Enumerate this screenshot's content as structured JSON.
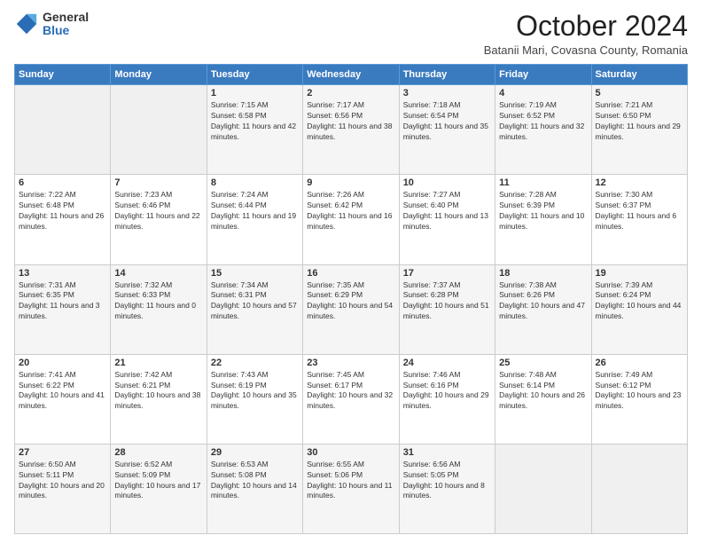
{
  "logo": {
    "general": "General",
    "blue": "Blue"
  },
  "header": {
    "month": "October 2024",
    "location": "Batanii Mari, Covasna County, Romania"
  },
  "days_of_week": [
    "Sunday",
    "Monday",
    "Tuesday",
    "Wednesday",
    "Thursday",
    "Friday",
    "Saturday"
  ],
  "weeks": [
    [
      {
        "day": "",
        "info": ""
      },
      {
        "day": "",
        "info": ""
      },
      {
        "day": "1",
        "info": "Sunrise: 7:15 AM\nSunset: 6:58 PM\nDaylight: 11 hours and 42 minutes."
      },
      {
        "day": "2",
        "info": "Sunrise: 7:17 AM\nSunset: 6:56 PM\nDaylight: 11 hours and 38 minutes."
      },
      {
        "day": "3",
        "info": "Sunrise: 7:18 AM\nSunset: 6:54 PM\nDaylight: 11 hours and 35 minutes."
      },
      {
        "day": "4",
        "info": "Sunrise: 7:19 AM\nSunset: 6:52 PM\nDaylight: 11 hours and 32 minutes."
      },
      {
        "day": "5",
        "info": "Sunrise: 7:21 AM\nSunset: 6:50 PM\nDaylight: 11 hours and 29 minutes."
      }
    ],
    [
      {
        "day": "6",
        "info": "Sunrise: 7:22 AM\nSunset: 6:48 PM\nDaylight: 11 hours and 26 minutes."
      },
      {
        "day": "7",
        "info": "Sunrise: 7:23 AM\nSunset: 6:46 PM\nDaylight: 11 hours and 22 minutes."
      },
      {
        "day": "8",
        "info": "Sunrise: 7:24 AM\nSunset: 6:44 PM\nDaylight: 11 hours and 19 minutes."
      },
      {
        "day": "9",
        "info": "Sunrise: 7:26 AM\nSunset: 6:42 PM\nDaylight: 11 hours and 16 minutes."
      },
      {
        "day": "10",
        "info": "Sunrise: 7:27 AM\nSunset: 6:40 PM\nDaylight: 11 hours and 13 minutes."
      },
      {
        "day": "11",
        "info": "Sunrise: 7:28 AM\nSunset: 6:39 PM\nDaylight: 11 hours and 10 minutes."
      },
      {
        "day": "12",
        "info": "Sunrise: 7:30 AM\nSunset: 6:37 PM\nDaylight: 11 hours and 6 minutes."
      }
    ],
    [
      {
        "day": "13",
        "info": "Sunrise: 7:31 AM\nSunset: 6:35 PM\nDaylight: 11 hours and 3 minutes."
      },
      {
        "day": "14",
        "info": "Sunrise: 7:32 AM\nSunset: 6:33 PM\nDaylight: 11 hours and 0 minutes."
      },
      {
        "day": "15",
        "info": "Sunrise: 7:34 AM\nSunset: 6:31 PM\nDaylight: 10 hours and 57 minutes."
      },
      {
        "day": "16",
        "info": "Sunrise: 7:35 AM\nSunset: 6:29 PM\nDaylight: 10 hours and 54 minutes."
      },
      {
        "day": "17",
        "info": "Sunrise: 7:37 AM\nSunset: 6:28 PM\nDaylight: 10 hours and 51 minutes."
      },
      {
        "day": "18",
        "info": "Sunrise: 7:38 AM\nSunset: 6:26 PM\nDaylight: 10 hours and 47 minutes."
      },
      {
        "day": "19",
        "info": "Sunrise: 7:39 AM\nSunset: 6:24 PM\nDaylight: 10 hours and 44 minutes."
      }
    ],
    [
      {
        "day": "20",
        "info": "Sunrise: 7:41 AM\nSunset: 6:22 PM\nDaylight: 10 hours and 41 minutes."
      },
      {
        "day": "21",
        "info": "Sunrise: 7:42 AM\nSunset: 6:21 PM\nDaylight: 10 hours and 38 minutes."
      },
      {
        "day": "22",
        "info": "Sunrise: 7:43 AM\nSunset: 6:19 PM\nDaylight: 10 hours and 35 minutes."
      },
      {
        "day": "23",
        "info": "Sunrise: 7:45 AM\nSunset: 6:17 PM\nDaylight: 10 hours and 32 minutes."
      },
      {
        "day": "24",
        "info": "Sunrise: 7:46 AM\nSunset: 6:16 PM\nDaylight: 10 hours and 29 minutes."
      },
      {
        "day": "25",
        "info": "Sunrise: 7:48 AM\nSunset: 6:14 PM\nDaylight: 10 hours and 26 minutes."
      },
      {
        "day": "26",
        "info": "Sunrise: 7:49 AM\nSunset: 6:12 PM\nDaylight: 10 hours and 23 minutes."
      }
    ],
    [
      {
        "day": "27",
        "info": "Sunrise: 6:50 AM\nSunset: 5:11 PM\nDaylight: 10 hours and 20 minutes."
      },
      {
        "day": "28",
        "info": "Sunrise: 6:52 AM\nSunset: 5:09 PM\nDaylight: 10 hours and 17 minutes."
      },
      {
        "day": "29",
        "info": "Sunrise: 6:53 AM\nSunset: 5:08 PM\nDaylight: 10 hours and 14 minutes."
      },
      {
        "day": "30",
        "info": "Sunrise: 6:55 AM\nSunset: 5:06 PM\nDaylight: 10 hours and 11 minutes."
      },
      {
        "day": "31",
        "info": "Sunrise: 6:56 AM\nSunset: 5:05 PM\nDaylight: 10 hours and 8 minutes."
      },
      {
        "day": "",
        "info": ""
      },
      {
        "day": "",
        "info": ""
      }
    ]
  ]
}
